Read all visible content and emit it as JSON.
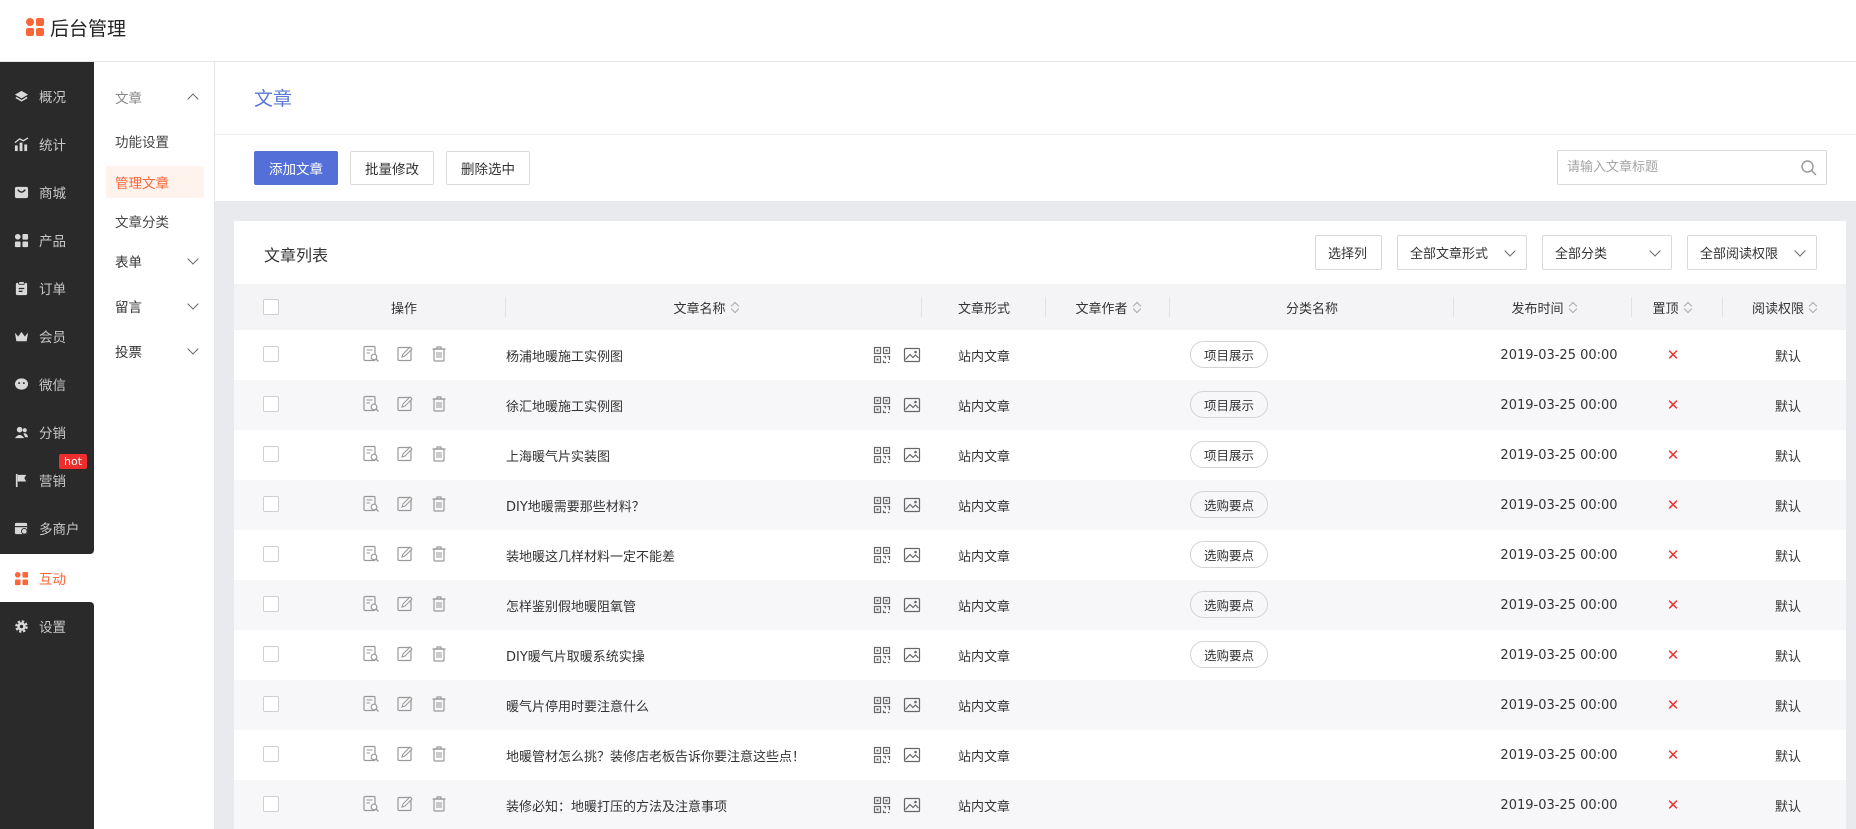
{
  "app": {
    "title": "后台管理"
  },
  "nav_primary": [
    {
      "label": "概况",
      "icon": "layers-icon"
    },
    {
      "label": "统计",
      "icon": "chart-icon"
    },
    {
      "label": "商城",
      "icon": "shop-icon"
    },
    {
      "label": "产品",
      "icon": "grid-icon"
    },
    {
      "label": "订单",
      "icon": "clipboard-icon"
    },
    {
      "label": "会员",
      "icon": "crown-icon"
    },
    {
      "label": "微信",
      "icon": "wechat-icon"
    },
    {
      "label": "分销",
      "icon": "users-icon"
    },
    {
      "label": "营销",
      "icon": "flag-icon"
    },
    {
      "label": "多商户",
      "icon": "store-icon"
    },
    {
      "label": "互动",
      "icon": "apps-icon"
    },
    {
      "label": "设置",
      "icon": "gear-icon"
    }
  ],
  "hot_badge": "hot",
  "nav_secondary": {
    "group": "文章",
    "items": [
      "功能设置",
      "管理文章",
      "文章分类"
    ],
    "collapsed_groups": [
      "表单",
      "留言",
      "投票"
    ]
  },
  "page": {
    "title": "文章"
  },
  "toolbar": {
    "add": "添加文章",
    "batch_edit": "批量修改",
    "delete_selected": "删除选中",
    "search_placeholder": "请输入文章标题"
  },
  "list": {
    "title": "文章列表",
    "choose_columns": "选择列",
    "filter_form": "全部文章形式",
    "filter_category": "全部分类",
    "filter_permission": "全部阅读权限"
  },
  "table": {
    "headers": {
      "ops": "操作",
      "name": "文章名称",
      "form": "文章形式",
      "author": "文章作者",
      "category": "分类名称",
      "date": "发布时间",
      "pin": "置顶",
      "permission": "阅读权限"
    },
    "rows": [
      {
        "name": "杨浦地暖施工实例图",
        "form": "站内文章",
        "category": "项目展示",
        "date": "2019-03-25 00:00",
        "pin": "✕",
        "permission": "默认"
      },
      {
        "name": "徐汇地暖施工实例图",
        "form": "站内文章",
        "category": "项目展示",
        "date": "2019-03-25 00:00",
        "pin": "✕",
        "permission": "默认"
      },
      {
        "name": "上海暖气片实装图",
        "form": "站内文章",
        "category": "项目展示",
        "date": "2019-03-25 00:00",
        "pin": "✕",
        "permission": "默认"
      },
      {
        "name": "DIY地暖需要那些材料？",
        "form": "站内文章",
        "category": "选购要点",
        "date": "2019-03-25 00:00",
        "pin": "✕",
        "permission": "默认"
      },
      {
        "name": "装地暖这几样材料一定不能差",
        "form": "站内文章",
        "category": "选购要点",
        "date": "2019-03-25 00:00",
        "pin": "✕",
        "permission": "默认"
      },
      {
        "name": "怎样鉴别假地暖阻氧管",
        "form": "站内文章",
        "category": "选购要点",
        "date": "2019-03-25 00:00",
        "pin": "✕",
        "permission": "默认"
      },
      {
        "name": "DIY暖气片取暖系统实操",
        "form": "站内文章",
        "category": "选购要点",
        "date": "2019-03-25 00:00",
        "pin": "✕",
        "permission": "默认"
      },
      {
        "name": "暖气片停用时要注意什么",
        "form": "站内文章",
        "category": "",
        "date": "2019-03-25 00:00",
        "pin": "✕",
        "permission": "默认"
      },
      {
        "name": "地暖管材怎么挑？装修店老板告诉你要注意这些点！",
        "form": "站内文章",
        "category": "",
        "date": "2019-03-25 00:00",
        "pin": "✕",
        "permission": "默认"
      },
      {
        "name": "装修必知：地暖打压的方法及注意事项",
        "form": "站内文章",
        "category": "",
        "date": "2019-03-25 00:00",
        "pin": "✕",
        "permission": "默认"
      }
    ]
  },
  "colors": {
    "accent": "#fb6638",
    "primary_button": "#5470d8",
    "title_blue": "#5b78d4",
    "sidebar_dark": "#2a2a2a",
    "pin_red": "#ee3333"
  }
}
